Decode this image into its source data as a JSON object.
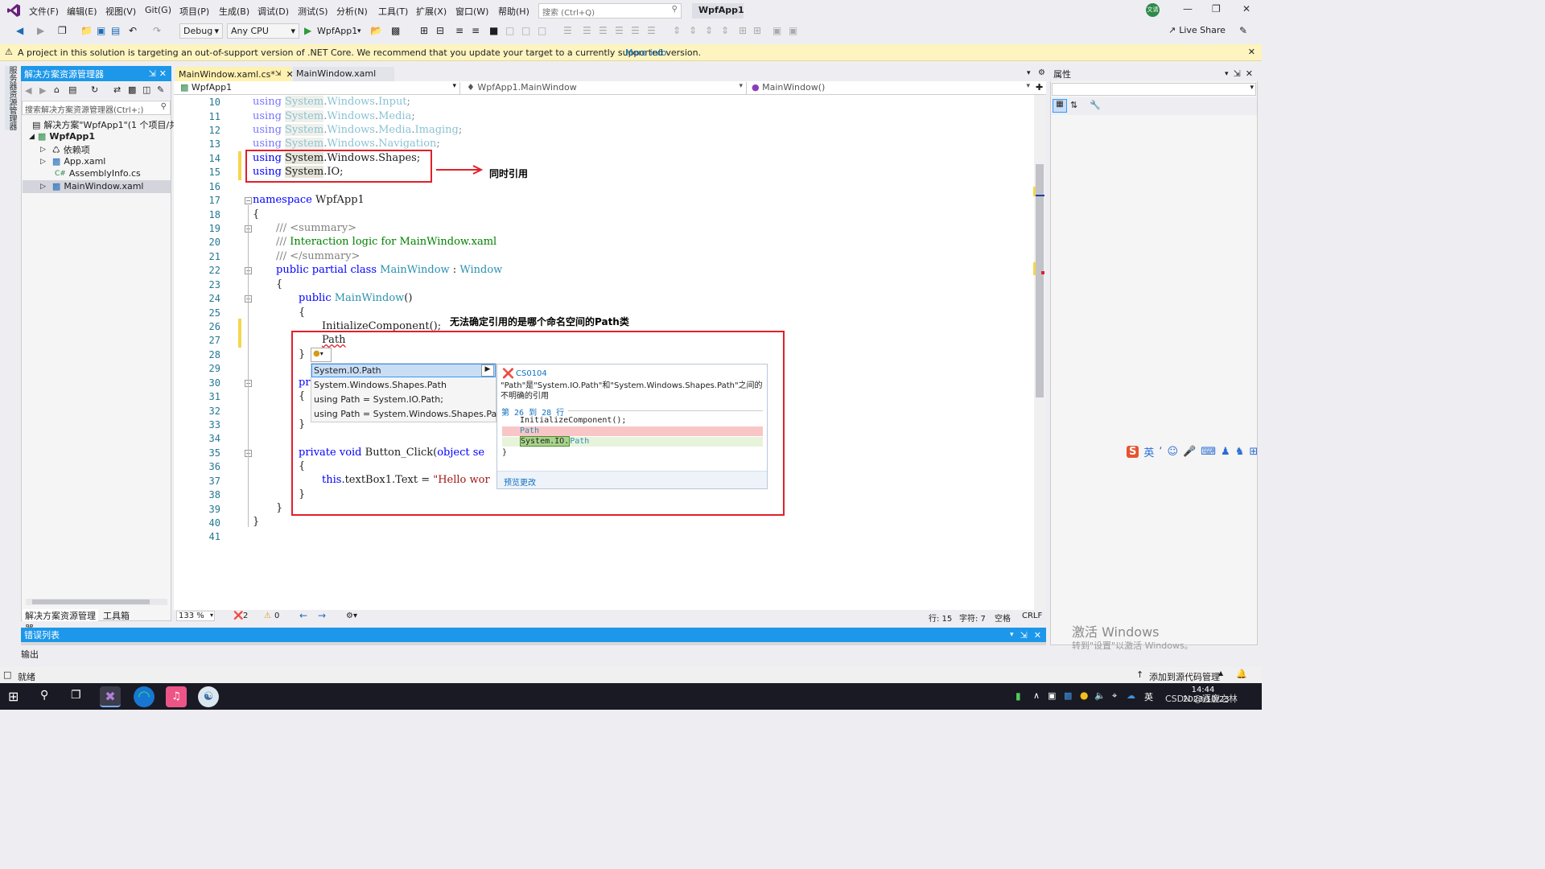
{
  "menubar": {
    "items": [
      "文件(F)",
      "编辑(E)",
      "视图(V)",
      "Git(G)",
      "项目(P)",
      "生成(B)",
      "调试(D)",
      "测试(S)",
      "分析(N)",
      "工具(T)",
      "扩展(X)",
      "窗口(W)",
      "帮助(H)"
    ],
    "search_placeholder": "搜索 (Ctrl+Q)",
    "app_name": "WpfApp1",
    "avatar": "文请"
  },
  "toolbar": {
    "config": "Debug",
    "platform": "Any CPU",
    "run_target": "WpfApp1",
    "live_share": "Live Share"
  },
  "infobar": {
    "message": "A project in this solution is targeting an out-of-support version of .NET Core. We recommend that you update your target to a currently supported version.",
    "link": "More info"
  },
  "left_strip": {
    "label": "服务器资源管理器"
  },
  "solution_explorer": {
    "title": "解决方案资源管理器",
    "search_placeholder": "搜索解决方案资源管理器(Ctrl+;)",
    "items": [
      "解决方案\"WpfApp1\"(1 个项目/共 1",
      "WpfApp1",
      "依赖项",
      "App.xaml",
      "AssemblyInfo.cs",
      "MainWindow.xaml"
    ],
    "tabs": [
      "解决方案资源管理器",
      "工具箱"
    ]
  },
  "editor": {
    "tabs": [
      "MainWindow.xaml.cs*",
      "MainWindow.xaml"
    ],
    "nav": [
      "WpfApp1",
      "WpfApp1.MainWindow",
      "MainWindow()"
    ],
    "line_numbers": [
      "10",
      "11",
      "12",
      "13",
      "14",
      "15",
      "16",
      "17",
      "18",
      "19",
      "20",
      "21",
      "22",
      "23",
      "24",
      "25",
      "26",
      "27",
      "28",
      "29",
      "30",
      "31",
      "32",
      "33",
      "34",
      "35",
      "36",
      "37",
      "38",
      "39",
      "40",
      "41"
    ],
    "code": {
      "l10": [
        "using ",
        "System",
        "Windows",
        "Input"
      ],
      "l11": [
        "using ",
        "System",
        "Windows",
        "Media"
      ],
      "l12": [
        "using ",
        "System",
        "Windows",
        "Media",
        "Imaging"
      ],
      "l13": [
        "using ",
        "System",
        "Windows",
        "Navigation"
      ],
      "l14": [
        "using ",
        "System",
        "Windows",
        "Shapes"
      ],
      "l15": [
        "using ",
        "System",
        "IO"
      ],
      "l17": [
        "namespace ",
        "WpfApp1"
      ],
      "l19": "/// <summary>",
      "l20": "Interaction logic for MainWindow.xaml",
      "l21": "/// </summary>",
      "l22": [
        "public ",
        "partial ",
        "class ",
        "MainWindow",
        "Window"
      ],
      "l24": [
        "public ",
        "MainWindow"
      ],
      "l26": "InitializeComponent",
      "l27": "Path",
      "l30": "pr",
      "l35": [
        "private ",
        "void ",
        "Button_Click",
        "object se"
      ],
      "l37": [
        "this",
        ".textBox1.Text = ",
        "\"Hello wor"
      ]
    },
    "annotation_1": "同时引用",
    "annotation_2": "无法确定引用的是哪个命名空间的Path类",
    "zoom": "133 %",
    "errors": "2",
    "warnings": "0",
    "pos_line": "行: 15",
    "pos_char": "字符: 7",
    "whitespace": "空格",
    "eol": "CRLF"
  },
  "quick_actions": {
    "items": [
      "System.IO.Path",
      "System.Windows.Shapes.Path",
      "using Path = System.IO.Path;",
      "using Path = System.Windows.Shapes.Path;"
    ],
    "error_code": "CS0104",
    "error_message": "\"Path\"是\"System.IO.Path\"和\"System.Windows.Shapes.Path\"之间的不明确的引用",
    "line_range": "第 26 到 28 行",
    "preview_l1": "InitializeComponent();",
    "preview_l2": "Path",
    "preview_l3a": "System.IO.",
    "preview_l3b": "Path",
    "preview_brace": "}",
    "preview_link": "预览更改"
  },
  "properties": {
    "title": "属性"
  },
  "bottom": {
    "error_list": "错误列表",
    "output": "输出",
    "status": "就绪",
    "source_control": "添加到源代码管理"
  },
  "watermark": {
    "line1": "激活 Windows",
    "line2": "转到\"设置\"以激活 Windows。"
  },
  "ime": {
    "label": "英"
  },
  "taskbar": {
    "time": "14:44",
    "date": "2023/10/23",
    "ime": "英",
    "csdn": "CSDN @逐鹿之林"
  },
  "colors": {
    "accent": "#1c97ea",
    "vs_purple": "#68217a",
    "keyword": "#0000ff",
    "type": "#2b91af",
    "comment": "#008000",
    "red_box": "#e0202b"
  }
}
